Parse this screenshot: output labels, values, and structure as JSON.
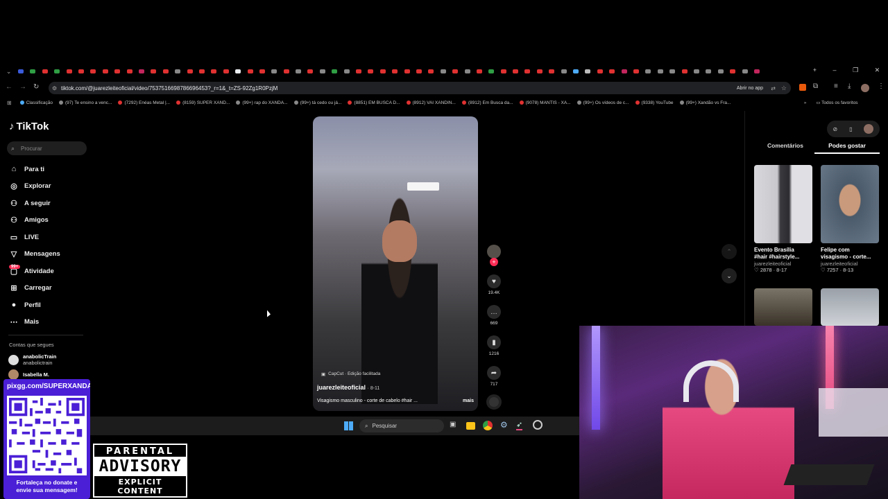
{
  "browser": {
    "url": "tiktok.com/@juarezleiteoficial/video/7537516698786696453?_r=1&_t=ZS-92Zg1R0PzjM",
    "open_in_app": "Abrir no app",
    "tab_colors": [
      "#3b5bdb",
      "#2f9e44",
      "#e03131",
      "#2f9e44",
      "#e03131",
      "#e03131",
      "#e03131",
      "#e03131",
      "#e03131",
      "#e03131",
      "#c2255c",
      "#e03131",
      "#e03131",
      "#888",
      "#e03131",
      "#e03131",
      "#e03131",
      "#e03131",
      "#e9ecef",
      "#e03131",
      "#e03131",
      "#888",
      "#e03131",
      "#888",
      "#e03131",
      "#888",
      "#2f9e44",
      "#888",
      "#e03131",
      "#e03131",
      "#e03131",
      "#e03131",
      "#e03131",
      "#e03131",
      "#e03131",
      "#888",
      "#e03131",
      "#888",
      "#e03131",
      "#2f9e44",
      "#e03131",
      "#e03131",
      "#e03131",
      "#e03131",
      "#e03131",
      "#888",
      "#4dabf7",
      "#bbb",
      "#e03131",
      "#e03131",
      "#c2255c",
      "#e03131",
      "#888",
      "#888",
      "#888",
      "#e03131",
      "#888",
      "#888",
      "#888",
      "#e03131",
      "#888",
      "#c2255c"
    ],
    "bookmarks": [
      {
        "label": "Classificação",
        "color": "#4dabf7"
      },
      {
        "label": "(97) Te ensino a venc...",
        "color": "#888"
      },
      {
        "label": "(7292) Enéas Metal |...",
        "color": "#e03131"
      },
      {
        "label": "(8159) SUPER XAND...",
        "color": "#e03131"
      },
      {
        "label": "(99+) rap do XANDÃ...",
        "color": "#888"
      },
      {
        "label": "(99+) tá cedo ou já...",
        "color": "#888"
      },
      {
        "label": "(8851) EM BUSCA D...",
        "color": "#e03131"
      },
      {
        "label": "(8912) VAI XANDIN...",
        "color": "#e03131"
      },
      {
        "label": "(8912) Em Busca da...",
        "color": "#e03131"
      },
      {
        "label": "(9078) MANTIS - XA...",
        "color": "#e03131"
      },
      {
        "label": "(99+) Os vídeos de c...",
        "color": "#888"
      },
      {
        "label": "(9338) YouTube",
        "color": "#e03131"
      },
      {
        "label": "(99+) Xandão vs Fra...",
        "color": "#888"
      }
    ],
    "all_favorites": "Todos os favoritos"
  },
  "sidebar": {
    "logo": "TikTok",
    "search_placeholder": "Procurar",
    "items": [
      {
        "label": "Para ti",
        "icon": "⌂"
      },
      {
        "label": "Explorar",
        "icon": "◎"
      },
      {
        "label": "A seguir",
        "icon": "⚇"
      },
      {
        "label": "Amigos",
        "icon": "⚇"
      },
      {
        "label": "LIVE",
        "icon": "▭"
      },
      {
        "label": "Mensagens",
        "icon": "▽"
      },
      {
        "label": "Atividade",
        "icon": "▢"
      },
      {
        "label": "Carregar",
        "icon": "⊞"
      },
      {
        "label": "Perfil",
        "icon": "●"
      },
      {
        "label": "Mais",
        "icon": "⋯"
      }
    ],
    "activity_badge": "99+",
    "following_title": "Contas que segues",
    "accounts": [
      {
        "name": "anabolicTrain",
        "handle": "anabolictrain"
      },
      {
        "name": "Isabella M.",
        "handle": ""
      }
    ]
  },
  "video": {
    "capcut": "CapCut · Edição facilitada",
    "author": "juarezleiteoficial",
    "date": "· 8-11",
    "caption": "Visagismo masculino - corte de cabelo #hair ...",
    "more": "mais",
    "likes": "19.4K",
    "comments": "669",
    "saves": "1216",
    "shares": "717"
  },
  "right_panel": {
    "tab_comments": "Comentários",
    "tab_suggested": "Podes gostar",
    "videos": [
      {
        "title_line1": "Evento Brasília",
        "title_line2": "#hair #hairstyle...",
        "author": "juarezleiteoficial",
        "likes": "2878",
        "date": "8-17"
      },
      {
        "title_line1": "Felipe com",
        "title_line2": "visagismo - corte...",
        "author": "juarezleiteoficial",
        "likes": "7257",
        "date": "8-13"
      }
    ]
  },
  "taskbar": {
    "search": "Pesquisar"
  },
  "overlay": {
    "pix_url": "pixgg.com/SUPERXANDA",
    "pix_text_1": "Fortaleça no donate e",
    "pix_text_2": "envie sua mensagem!",
    "pa_line1": "PARENTAL",
    "pa_line2": "ADVISORY",
    "pa_line3": "EXPLICIT CONTENT"
  }
}
